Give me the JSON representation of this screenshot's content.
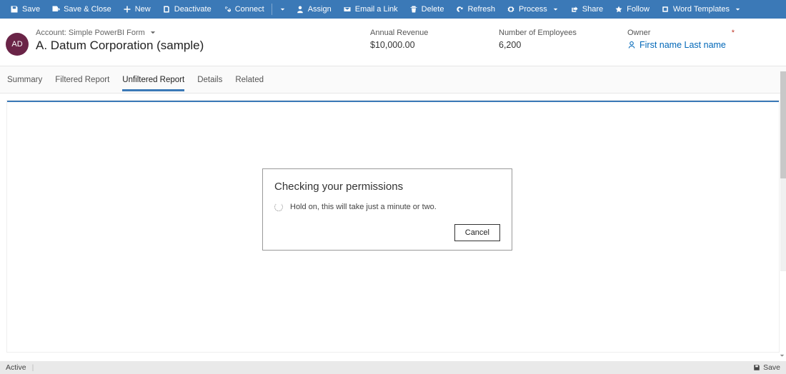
{
  "commands": {
    "save": "Save",
    "save_close": "Save & Close",
    "new": "New",
    "deactivate": "Deactivate",
    "connect": "Connect",
    "assign": "Assign",
    "email_link": "Email a Link",
    "delete": "Delete",
    "refresh": "Refresh",
    "process": "Process",
    "share": "Share",
    "follow": "Follow",
    "word_templates": "Word Templates"
  },
  "header": {
    "avatar_initials": "AD",
    "account_line": "Account: Simple PowerBI Form",
    "record_name": "A. Datum Corporation (sample)",
    "fields": {
      "annual_revenue": {
        "label": "Annual Revenue",
        "value": "$10,000.00"
      },
      "num_employees": {
        "label": "Number of Employees",
        "value": "6,200"
      },
      "owner": {
        "label": "Owner",
        "required": "*",
        "value": "First name Last name"
      }
    }
  },
  "tabs": {
    "summary": "Summary",
    "filtered": "Filtered Report",
    "unfiltered": "Unfiltered Report",
    "details": "Details",
    "related": "Related",
    "active": "unfiltered"
  },
  "modal": {
    "title": "Checking your permissions",
    "body": "Hold on, this will take just a minute or two.",
    "cancel": "Cancel"
  },
  "statusbar": {
    "left": "Active",
    "save": "Save"
  }
}
